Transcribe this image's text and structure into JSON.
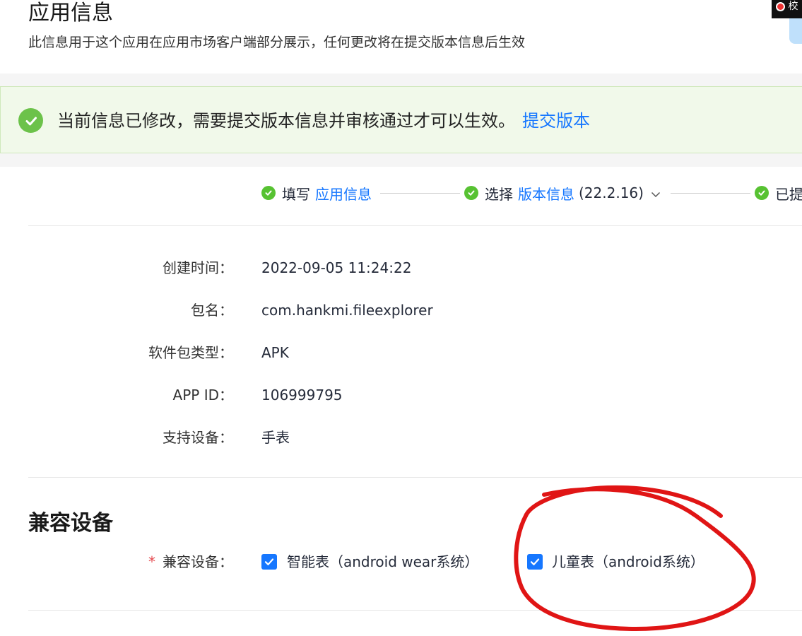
{
  "header": {
    "title": "应用信息",
    "description": "此信息用于这个应用在应用市场客户端部分展示，任何更改将在提交版本信息后生效",
    "corner_badge": "校"
  },
  "notice": {
    "icon": "check-circle-icon",
    "text": "当前信息已修改，需要提交版本信息并审核通过才可以生效。",
    "link": "提交版本"
  },
  "steps": [
    {
      "prefix": "填写",
      "link": "应用信息",
      "suffix": ""
    },
    {
      "prefix": "选择",
      "link": "版本信息",
      "suffix": "(22.2.16)"
    },
    {
      "prefix": "已提",
      "link": "",
      "suffix": ""
    }
  ],
  "info": [
    {
      "label": "创建时间：",
      "value": "2022-09-05 11:24:22"
    },
    {
      "label": "包名：",
      "value": "com.hankmi.fileexplorer"
    },
    {
      "label": "软件包类型：",
      "value": "APK"
    },
    {
      "label": "APP ID：",
      "value": "106999795"
    },
    {
      "label": "支持设备：",
      "value": "手表"
    }
  ],
  "compat": {
    "section_title": "兼容设备",
    "required_mark": "*",
    "label": "兼容设备：",
    "options": [
      {
        "label": "智能表（android wear系统）",
        "checked": true
      },
      {
        "label": "儿童表（android系统）",
        "checked": true
      }
    ]
  },
  "colors": {
    "link": "#1677ff",
    "success": "#57c232",
    "annotation": "#e01515"
  }
}
